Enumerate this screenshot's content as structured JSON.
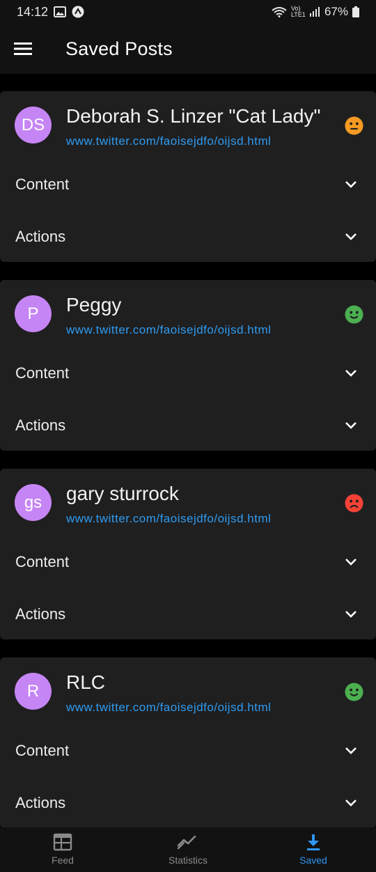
{
  "status_bar": {
    "time": "14:12",
    "network_label": "Vo) LTE1",
    "battery": "67%"
  },
  "app_bar": {
    "title": "Saved Posts",
    "menu_icon": "hamburger-menu-icon"
  },
  "posts": [
    {
      "initials": "DS",
      "author": "Deborah S. Linzer \"Cat Lady\"",
      "link": "www.twitter.com/faoisejdfo/oijsd.html",
      "sentiment": "neutral",
      "sentiment_color": "#f59a23",
      "content_label": "Content",
      "actions_label": "Actions"
    },
    {
      "initials": "P",
      "author": "Peggy",
      "link": "www.twitter.com/faoisejdfo/oijsd.html",
      "sentiment": "positive",
      "sentiment_color": "#4caf50",
      "content_label": "Content",
      "actions_label": "Actions"
    },
    {
      "initials": "gs",
      "author": "gary sturrock",
      "link": "www.twitter.com/faoisejdfo/oijsd.html",
      "sentiment": "negative",
      "sentiment_color": "#f44336",
      "content_label": "Content",
      "actions_label": "Actions"
    },
    {
      "initials": "R",
      "author": "RLC",
      "link": "www.twitter.com/faoisejdfo/oijsd.html",
      "sentiment": "positive",
      "sentiment_color": "#4caf50",
      "content_label": "Content",
      "actions_label": "Actions"
    }
  ],
  "bottom_nav": {
    "items": [
      {
        "label": "Feed",
        "icon": "feed-icon",
        "active": false
      },
      {
        "label": "Statistics",
        "icon": "statistics-icon",
        "active": false
      },
      {
        "label": "Saved",
        "icon": "download-icon",
        "active": true
      }
    ]
  },
  "colors": {
    "accent": "#2f95f3",
    "avatar": "#c685f5",
    "card": "#1f1f20"
  }
}
